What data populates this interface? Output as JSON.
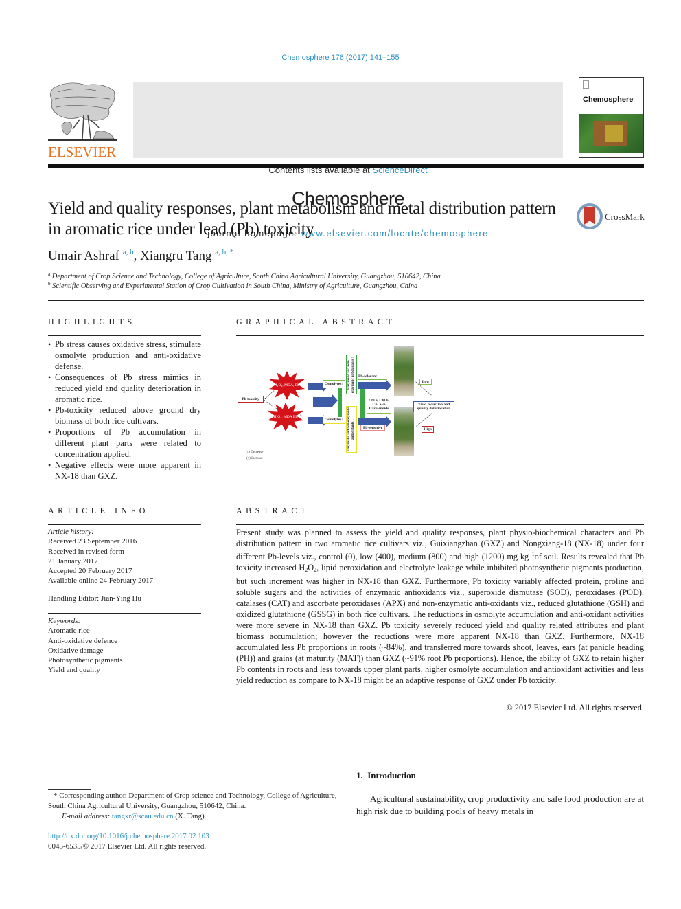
{
  "journal_ref": "Chemosphere 176 (2017) 141–155",
  "header": {
    "publisher_logo_text": "ELSEVIER",
    "contents_prefix": "Contents lists available at ",
    "contents_link": "ScienceDirect",
    "journal_name": "Chemosphere",
    "homepage_prefix": "journal homepage: ",
    "homepage_link": "www.elsevier.com/locate/chemosphere",
    "cover_title": "Chemosphere"
  },
  "article": {
    "title": "Yield and quality responses, plant metabolism and metal distribution pattern in aromatic rice under lead (Pb) toxicity",
    "crossmark_label": "CrossMark",
    "authors": [
      {
        "name": "Umair Ashraf",
        "sup": "a, b"
      },
      {
        "name": "Xiangru Tang",
        "sup": "a, b, *"
      }
    ],
    "author_separator": ", ",
    "affiliations": [
      {
        "mark": "a",
        "text": "Department of Crop Science and Technology, College of Agriculture, South China Agricultural University, Guangzhou, 510642, China"
      },
      {
        "mark": "b",
        "text": "Scientific Observing and Experimental Station of Crop Cultivation in South China, Ministry of Agriculture, Guangzhou, China"
      }
    ]
  },
  "highlights": {
    "heading": "HIGHLIGHTS",
    "items": [
      "Pb stress causes oxidative stress, stimulate osmolyte production and anti-oxidative defense.",
      "Consequences of Pb stress mimics in reduced yield and quality deterioration in aromatic rice.",
      "Pb-toxicity reduced above ground dry biomass of both rice cultivars.",
      "Proportions of Pb accumulation in different plant parts were related to concentration applied.",
      "Negative effects were more apparent in NX-18 than GXZ."
    ]
  },
  "graphical_abstract": {
    "heading": "GRAPHICAL ABSTRACT",
    "pb_toxicity": "Pb toxicity",
    "star_top": "H₂O₂, MDA, EL",
    "star_bottom": "H₂O₂, MDA EL",
    "star_arrow": "↑",
    "osmolytes_top": "Osmolytes↑",
    "osmolytes_bottom": "Osmolytes↓",
    "antioxidants_top": "Enzymatic and non-enzymatic antioxidants ↑",
    "antioxidants_bottom": "Enzymatic and non-enzymatic antioxidants ↓",
    "pb_tolerant": "Pb-tolerant",
    "pb_sensitive": "Pb-sensitive",
    "pigments": "Chl a, Chl b, Chl a+b Carotenoids",
    "low": "Low",
    "high": "High",
    "yield_box": "Yield reduction and quality deterioration",
    "legend_decrease": "(↓) Decrease",
    "legend_increase": "(↑) Increase"
  },
  "article_info": {
    "heading": "ARTICLE INFO",
    "history_label": "Article history:",
    "history": [
      "Received 23 September 2016",
      "Received in revised form",
      "21 January 2017",
      "Accepted 20 February 2017",
      "Available online 24 February 2017"
    ],
    "handling_editor": "Handling Editor: Jian-Ying Hu",
    "keywords_label": "Keywords:",
    "keywords": [
      "Aromatic rice",
      "Anti-oxidative defence",
      "Oxidative damage",
      "Photosynthetic pigments",
      "Yield and quality"
    ]
  },
  "abstract": {
    "heading": "ABSTRACT",
    "part1": "Present study was planned to assess the yield and quality responses, plant physio-biochemical characters and Pb distribution pattern in two aromatic rice cultivars viz., Guixiangzhan (GXZ) and Nongxiang-18 (NX-18) under four different Pb-levels viz., control (0), low (400), medium (800) and high (1200) mg kg",
    "sup": "−1",
    "part2": "of soil. Results revealed that Pb toxicity increased H",
    "sub1": "2",
    "part3": "O",
    "sub2": "2",
    "part4": ", lipid peroxidation and electrolyte leakage while inhibited photosynthetic pigments production, but such increment was higher in NX-18 than GXZ. Furthermore, Pb toxicity variably affected protein, proline and soluble sugars and the activities of enzymatic antioxidants viz., superoxide dismutase (SOD), peroxidases (POD), catalases (CAT) and ascorbate peroxidases (APX) and non-enzymatic anti-oxidants viz., reduced glutathione (GSH) and oxidized glutathione (GSSG) in both rice cultivars. The reductions in osmolyte accumulation and anti-oxidant activities were more severe in NX-18 than GXZ. Pb toxicity severely reduced yield and quality related attributes and plant biomass accumulation; however the reductions were more apparent NX-18 than GXZ. Furthermore, NX-18 accumulated less Pb proportions in roots (~84%), and transferred more towards shoot, leaves, ears (at panicle heading (PH)) and grains (at maturity (MAT)) than GXZ (~91% root Pb proportions). Hence, the ability of GXZ to retain higher Pb contents in roots and less towards upper plant parts, higher osmolyte accumulation and antioxidant activities and less yield reduction as compare to NX-18 might be an adaptive response of GXZ under Pb toxicity.",
    "copyright": "© 2017 Elsevier Ltd. All rights reserved."
  },
  "footnotes": {
    "corresponding": "* Corresponding author. Department of Crop science and Technology, College of Agriculture, South China Agricultural University, Guangzhou, 510642, China.",
    "email_label": "E-mail address: ",
    "email": "tangxr@scau.edu.cn",
    "email_suffix": " (X. Tang).",
    "doi": "http://dx.doi.org/10.1016/j.chemosphere.2017.02.103",
    "issn": "0045-6535/© 2017 Elsevier Ltd. All rights reserved."
  },
  "introduction": {
    "heading": "1.  Introduction",
    "text": "Agricultural sustainability, crop productivity and safe food production are at high risk due to building pools of heavy metals in"
  }
}
